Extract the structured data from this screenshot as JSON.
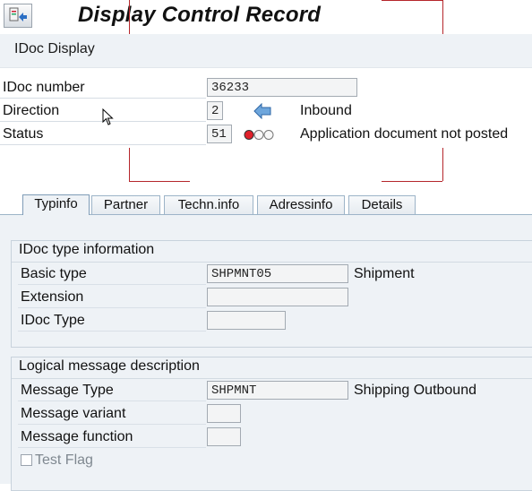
{
  "window": {
    "title": "Display Control Record"
  },
  "toolbar": {
    "idoc_display_label": "IDoc Display"
  },
  "header": {
    "idoc_number": {
      "label": "IDoc number",
      "value": "36233"
    },
    "direction": {
      "label": "Direction",
      "value": "2",
      "text": "Inbound",
      "icon": "arrow-left-icon"
    },
    "status": {
      "label": "Status",
      "value": "51",
      "text": "Application document not posted",
      "icon": "traffic-light-red-icon"
    }
  },
  "tabs": [
    {
      "label": "Typinfo",
      "active": true
    },
    {
      "label": "Partner"
    },
    {
      "label": "Techn.info"
    },
    {
      "label": "Adressinfo"
    },
    {
      "label": "Details"
    }
  ],
  "idoc_type_group": {
    "title": "IDoc type information",
    "basic_type": {
      "label": "Basic type",
      "value": "SHPMNT05",
      "text": "Shipment"
    },
    "extension": {
      "label": "Extension",
      "value": ""
    },
    "idoc_type": {
      "label": "IDoc Type",
      "value": ""
    }
  },
  "logical_message_group": {
    "title": "Logical message description",
    "message_type": {
      "label": "Message Type",
      "value": "SHPMNT",
      "text": "Shipping Outbound"
    },
    "message_variant": {
      "label": "Message variant",
      "value": ""
    },
    "message_function": {
      "label": "Message function",
      "value": ""
    },
    "test_flag": {
      "label": "Test Flag",
      "checked": false
    }
  },
  "colors": {
    "frame_red": "#b5262b",
    "tab_border": "#9db4c8",
    "panel_bg": "#eef2f6"
  }
}
